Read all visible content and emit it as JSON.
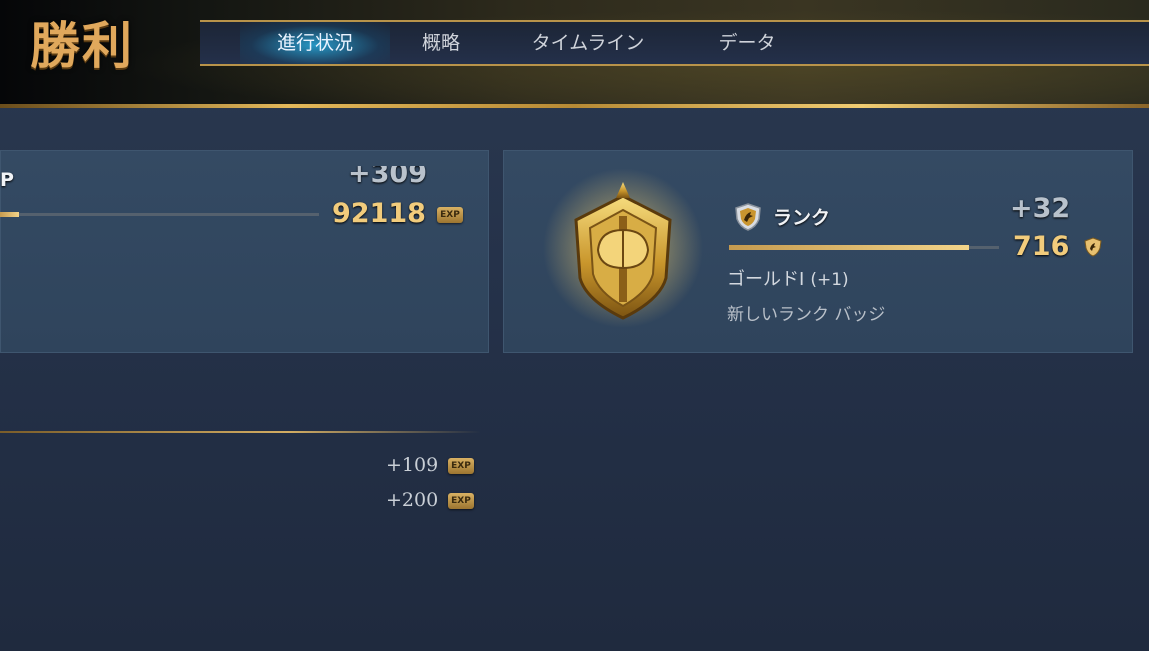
{
  "header": {
    "title": "勝利",
    "tabs": [
      {
        "label": "進行状況",
        "active": true
      },
      {
        "label": "概略",
        "active": false
      },
      {
        "label": "タイムライン",
        "active": false
      },
      {
        "label": "データ",
        "active": false
      }
    ]
  },
  "xp_panel": {
    "label_fragment": "P",
    "gain": "+309",
    "total": "92118",
    "exp_badge": "EXP",
    "progress_fraction": 0.06
  },
  "rank_panel": {
    "label": "ランク",
    "gain": "+32",
    "points": "716",
    "tier": "ゴールドⅠ",
    "tier_change": "(+1)",
    "new_badge_text": "新しいランク バッジ",
    "progress_fraction": 0.89,
    "badge_icon": "gold-axe-shield-icon"
  },
  "breakdown": [
    {
      "value": "+109",
      "badge": "EXP"
    },
    {
      "value": "+200",
      "badge": "EXP"
    }
  ],
  "colors": {
    "gold": "#f2cc7c",
    "accent_tab": "#28aadc",
    "panel": "#344a63"
  }
}
